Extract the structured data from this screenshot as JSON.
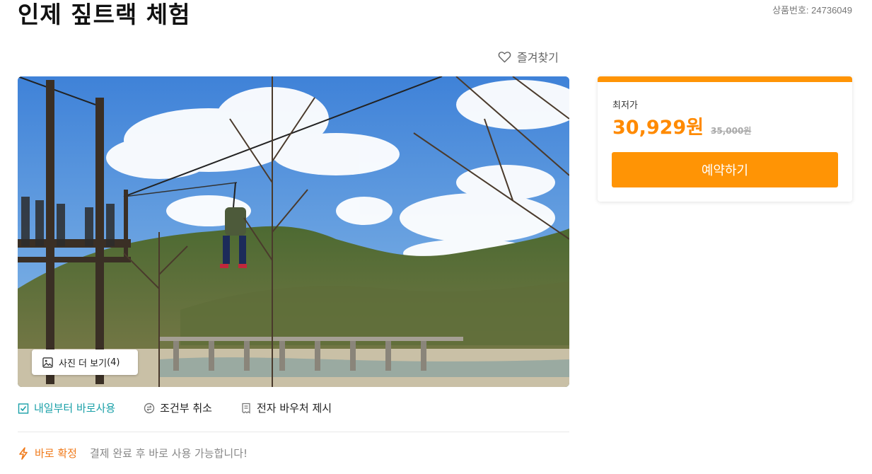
{
  "page": {
    "title": "인제 짚트랙 체험",
    "product_no": "상품번호: 24736049"
  },
  "favorite": {
    "label": "즐겨찾기",
    "icon": "heart-outline-icon"
  },
  "gallery": {
    "more_photos_label": "사진 더 보기",
    "photo_count": "(4)",
    "icon": "image-icon"
  },
  "features": [
    {
      "label": "내일부터 바로사용",
      "icon": "calendar-check-icon",
      "color": "#1aa0a8"
    },
    {
      "label": "조건부 취소",
      "icon": "exchange-circle-icon",
      "color": "#222222"
    },
    {
      "label": "전자 바우처 제시",
      "icon": "receipt-icon",
      "color": "#222222"
    }
  ],
  "confirmation": {
    "label": "바로 확정",
    "description": "결제 완료 후 바로 사용 가능합니다!",
    "icon": "lightning-icon",
    "color": "#f07a1a"
  },
  "price_card": {
    "lowest_label": "최저가",
    "price": "30,929원",
    "original_price": "35,000원",
    "book_label": "예약하기",
    "accent_color": "#ff9405"
  }
}
